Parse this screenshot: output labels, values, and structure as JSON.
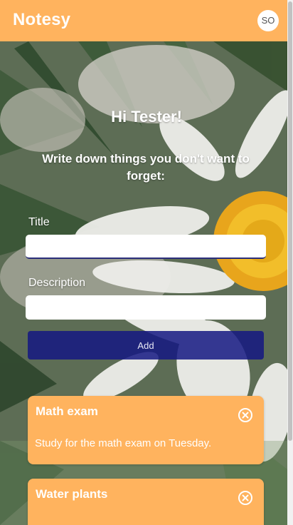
{
  "header": {
    "brand": "Notesy",
    "avatar_initials": "SO",
    "color": "#ffb35e"
  },
  "main": {
    "greeting": "Hi Tester!",
    "subheading": "Write down things you don't want to forget:",
    "title_label": "Title",
    "title_value": "",
    "description_label": "Description",
    "description_value": "",
    "add_label": "Add"
  },
  "notes": [
    {
      "title": "Math exam",
      "description": "Study for the math exam on Tuesday.",
      "close_icon": "close-circle-icon"
    },
    {
      "title": "Water plants",
      "description": "",
      "close_icon": "close-circle-icon"
    }
  ],
  "colors": {
    "accent": "#ffb35e",
    "button": "#141882"
  }
}
